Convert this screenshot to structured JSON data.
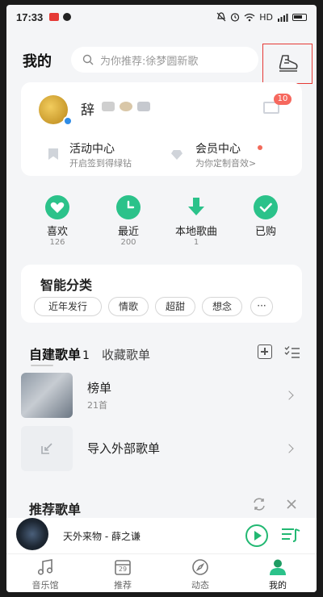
{
  "status_bar": {
    "time": "17:33",
    "network": "HD"
  },
  "header": {
    "title": "我的",
    "search_placeholder": "为你推荐:徐梦圆新歌"
  },
  "profile": {
    "username": "辞",
    "message_badge": "10",
    "shortcuts": [
      {
        "title": "活动中心",
        "subtitle": "开启签到得绿钻"
      },
      {
        "title": "会员中心",
        "subtitle": "为你定制音效>"
      }
    ]
  },
  "quick_actions": [
    {
      "label": "喜欢",
      "count": "126",
      "icon": "heart-icon"
    },
    {
      "label": "最近",
      "count": "200",
      "icon": "clock-icon"
    },
    {
      "label": "本地歌曲",
      "count": "1",
      "icon": "download-icon"
    },
    {
      "label": "已购",
      "count": "",
      "icon": "check-icon"
    }
  ],
  "smart_category": {
    "title": "智能分类",
    "chips": [
      "近年发行",
      "情歌",
      "超甜",
      "想念",
      "···"
    ]
  },
  "playlists": {
    "tabs": [
      {
        "label": "自建歌单",
        "count": "1"
      },
      {
        "label": "收藏歌单"
      }
    ],
    "items": [
      {
        "name": "榜单",
        "count": "21首"
      },
      {
        "name": "导入外部歌单",
        "count": ""
      }
    ]
  },
  "recommended": {
    "title": "推荐歌单"
  },
  "player": {
    "song": "天外来物 - 薛之谦"
  },
  "tabbar": [
    {
      "label": "音乐馆",
      "icon": "music-note-icon"
    },
    {
      "label": "推荐",
      "icon": "calendar-icon",
      "date": "29"
    },
    {
      "label": "动态",
      "icon": "compass-icon"
    },
    {
      "label": "我的",
      "icon": "user-icon"
    }
  ],
  "colors": {
    "accent": "#2BC28A",
    "badge": "#F6685E",
    "highlight_box": "#E53935"
  }
}
